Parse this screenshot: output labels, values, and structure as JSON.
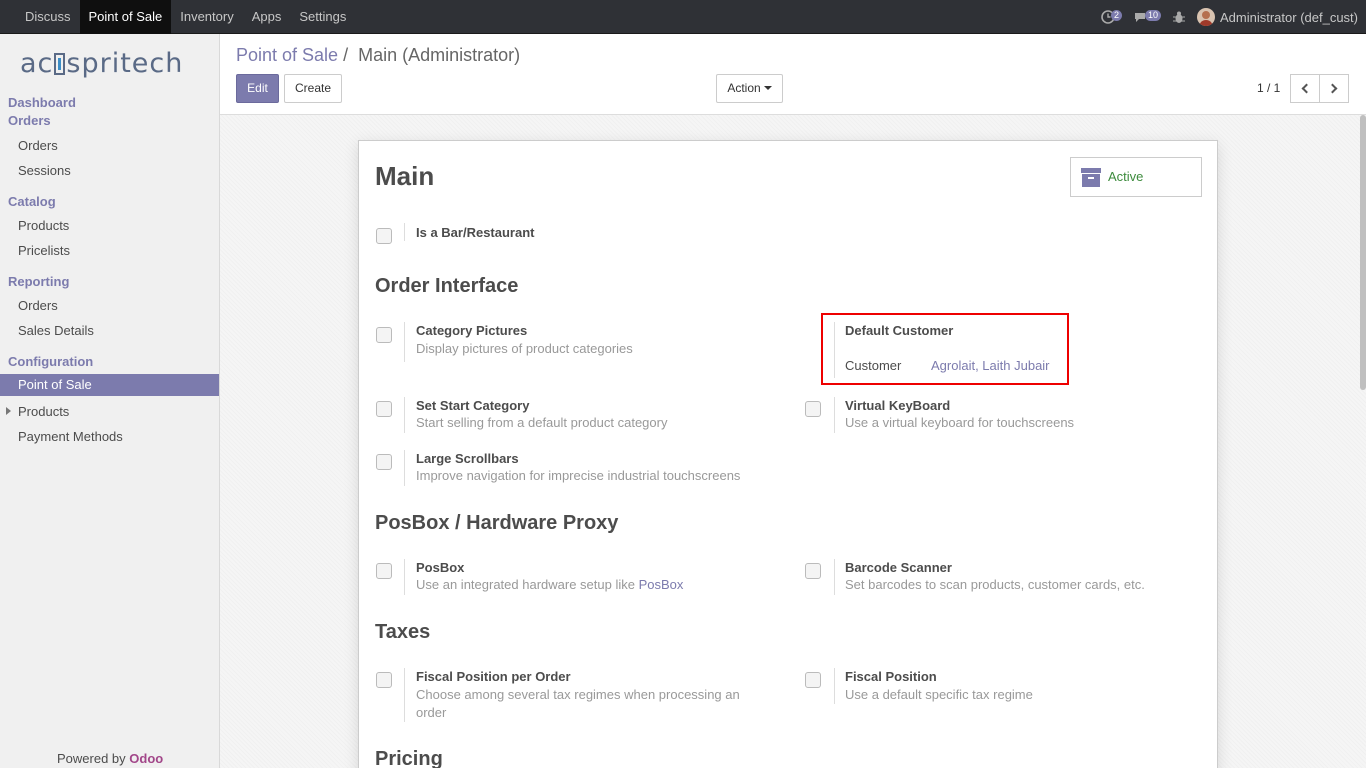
{
  "topbar": {
    "menu": [
      "Discuss",
      "Point of Sale",
      "Inventory",
      "Apps",
      "Settings"
    ],
    "activities_count": "2",
    "messages_count": "10",
    "user": "Administrator (def_cust)"
  },
  "sidebar": {
    "logo": "acspritech",
    "dashboard": "Dashboard",
    "orders_head": "Orders",
    "orders": "Orders",
    "sessions": "Sessions",
    "catalog": "Catalog",
    "products": "Products",
    "pricelists": "Pricelists",
    "reporting": "Reporting",
    "rep_orders": "Orders",
    "sales_details": "Sales Details",
    "configuration": "Configuration",
    "point_of_sale": "Point of Sale",
    "cfg_products": "Products",
    "payment_methods": "Payment Methods",
    "powered_by": "Powered by",
    "brand": "Odoo"
  },
  "control": {
    "breadcrumb_parent": "Point of Sale",
    "breadcrumb_sep": "/",
    "breadcrumb_current": "Main (Administrator)",
    "edit": "Edit",
    "create": "Create",
    "action": "Action",
    "pager": "1 / 1"
  },
  "form": {
    "title": "Main",
    "active": "Active",
    "bar_restaurant": "Is a Bar/Restaurant",
    "sections": {
      "order_interface": "Order Interface",
      "posbox": "PosBox / Hardware Proxy",
      "taxes": "Taxes",
      "pricing": "Pricing"
    },
    "category_pictures": {
      "title": "Category Pictures",
      "desc": "Display pictures of product categories"
    },
    "default_customer": {
      "title": "Default Customer",
      "label": "Customer",
      "value": "Agrolait, Laith Jubair"
    },
    "start_category": {
      "title": "Set Start Category",
      "desc": "Start selling from a default product category"
    },
    "virtual_keyboard": {
      "title": "Virtual KeyBoard",
      "desc": "Use a virtual keyboard for touchscreens"
    },
    "large_scrollbars": {
      "title": "Large Scrollbars",
      "desc": "Improve navigation for imprecise industrial touchscreens"
    },
    "posbox": {
      "title": "PosBox",
      "desc": "Use an integrated hardware setup like",
      "link": "PosBox"
    },
    "barcode": {
      "title": "Barcode Scanner",
      "desc": "Set barcodes to scan products, customer cards, etc."
    },
    "fiscal_per_order": {
      "title": "Fiscal Position per Order",
      "desc": "Choose among several tax regimes when processing an order"
    },
    "fiscal_position": {
      "title": "Fiscal Position",
      "desc": "Use a default specific tax regime"
    }
  }
}
